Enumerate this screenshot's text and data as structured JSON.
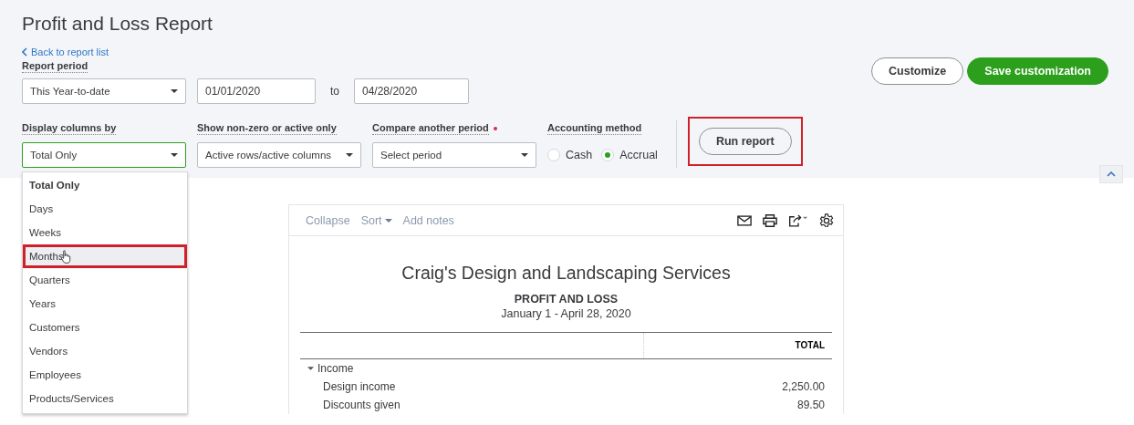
{
  "page": {
    "title": "Profit and Loss Report",
    "back_link": "Back to report list"
  },
  "header_buttons": [
    {
      "label": "Customize",
      "kind": "secondary"
    },
    {
      "label": "Save customization",
      "kind": "primary"
    }
  ],
  "report_period": {
    "label": "Report period",
    "preset": "This Year-to-date",
    "from": "01/01/2020",
    "to_label": "to",
    "to": "04/28/2020"
  },
  "filters": [
    {
      "label": "Display columns by",
      "value": "Total Only",
      "focused": true,
      "required": false
    },
    {
      "label": "Show non-zero or active only",
      "value": "Active rows/active columns",
      "focused": false,
      "required": false
    },
    {
      "label": "Compare another period",
      "value": "Select period",
      "focused": false,
      "required": true
    }
  ],
  "accounting_method": {
    "label": "Accounting method",
    "options": [
      {
        "label": "Cash",
        "selected": false
      },
      {
        "label": "Accrual",
        "selected": true
      }
    ]
  },
  "run_report": {
    "label": "Run report",
    "highlighted": true
  },
  "dropdown": {
    "items": [
      {
        "label": "Total Only",
        "selected": true,
        "highlighted": false
      },
      {
        "label": "Days",
        "selected": false,
        "highlighted": false
      },
      {
        "label": "Weeks",
        "selected": false,
        "highlighted": false
      },
      {
        "label": "Months",
        "selected": false,
        "highlighted": true
      },
      {
        "label": "Quarters",
        "selected": false,
        "highlighted": false
      },
      {
        "label": "Years",
        "selected": false,
        "highlighted": false
      },
      {
        "label": "Customers",
        "selected": false,
        "highlighted": false
      },
      {
        "label": "Vendors",
        "selected": false,
        "highlighted": false
      },
      {
        "label": "Employees",
        "selected": false,
        "highlighted": false
      },
      {
        "label": "Products/Services",
        "selected": false,
        "highlighted": false
      }
    ]
  },
  "report": {
    "toolbar": [
      {
        "label": "Collapse",
        "kind": "link"
      },
      {
        "label": "Sort",
        "kind": "menu"
      },
      {
        "label": "Add notes",
        "kind": "link"
      }
    ],
    "company": "Craig's Design and Landscaping Services",
    "title": "PROFIT AND LOSS",
    "period": "January 1 - April 28, 2020",
    "column_header": "TOTAL",
    "rows": [
      {
        "label": "Income",
        "expanded": true,
        "children": [
          {
            "label": "Design income",
            "total": "2,250.00"
          },
          {
            "label": "Discounts given",
            "total": "89.50"
          }
        ]
      }
    ]
  }
}
